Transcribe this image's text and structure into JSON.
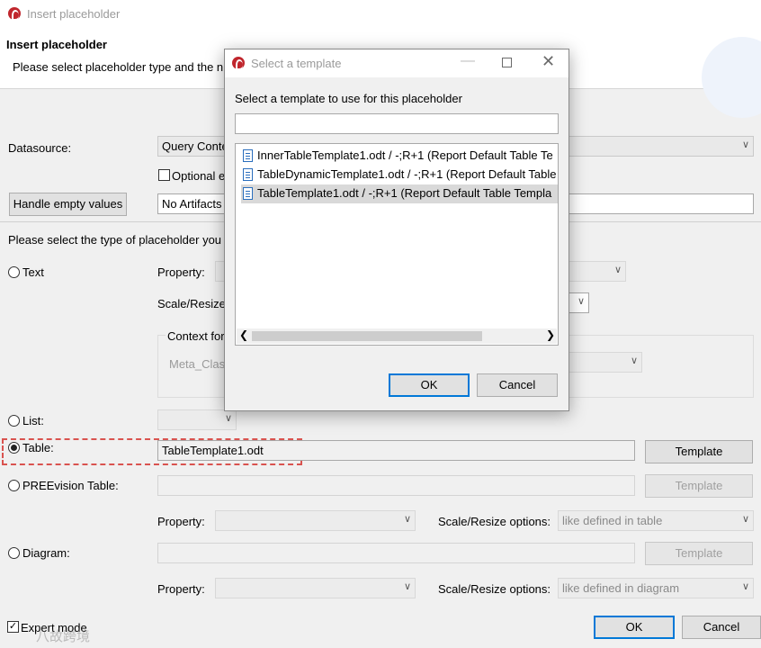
{
  "main_window": {
    "title": "Insert placeholder",
    "header_title": "Insert placeholder",
    "header_subtitle": "Please select placeholder type and the n",
    "datasource_label": "Datasource:",
    "datasource_value": "Query Conte",
    "optional_label": "Optional e",
    "handle_empty_button": "Handle empty values",
    "artifacts_value": "No Artifacts",
    "type_prompt": "Please select the type of placeholder you",
    "text_option": "Text",
    "property_label": "Property:",
    "scale_resize_label": "Scale/Resize",
    "context_group_label": "Context for",
    "context_value": "Meta_Class",
    "list_option": "List:",
    "table_option": "Table:",
    "table_template_value": "TableTemplate1.odt",
    "template_button": "Template",
    "preevision_option": "PREEvision Table:",
    "preevision_template_button": "Template",
    "table_property_label": "Property:",
    "table_scale_label": "Scale/Resize options:",
    "table_scale_value": "like defined in table",
    "diagram_option": "Diagram:",
    "diagram_template_button": "Template",
    "diagram_property_label": "Property:",
    "diagram_scale_label": "Scale/Resize options:",
    "diagram_scale_value": "like defined in diagram",
    "expert_mode_label": "Expert mode",
    "ok_button": "OK",
    "cancel_button": "Cancel",
    "watermark": "八故跨境"
  },
  "dialog": {
    "title": "Select a template",
    "prompt": "Select a template to use for this placeholder",
    "filter_value": "",
    "templates": [
      "InnerTableTemplate1.odt / -;R+1 (Report Default Table Te",
      "TableDynamicTemplate1.odt / -;R+1 (Report Default Table",
      "TableTemplate1.odt / -;R+1 (Report Default Table Templa"
    ],
    "selected_index": 2,
    "ok_button": "OK",
    "cancel_button": "Cancel"
  }
}
